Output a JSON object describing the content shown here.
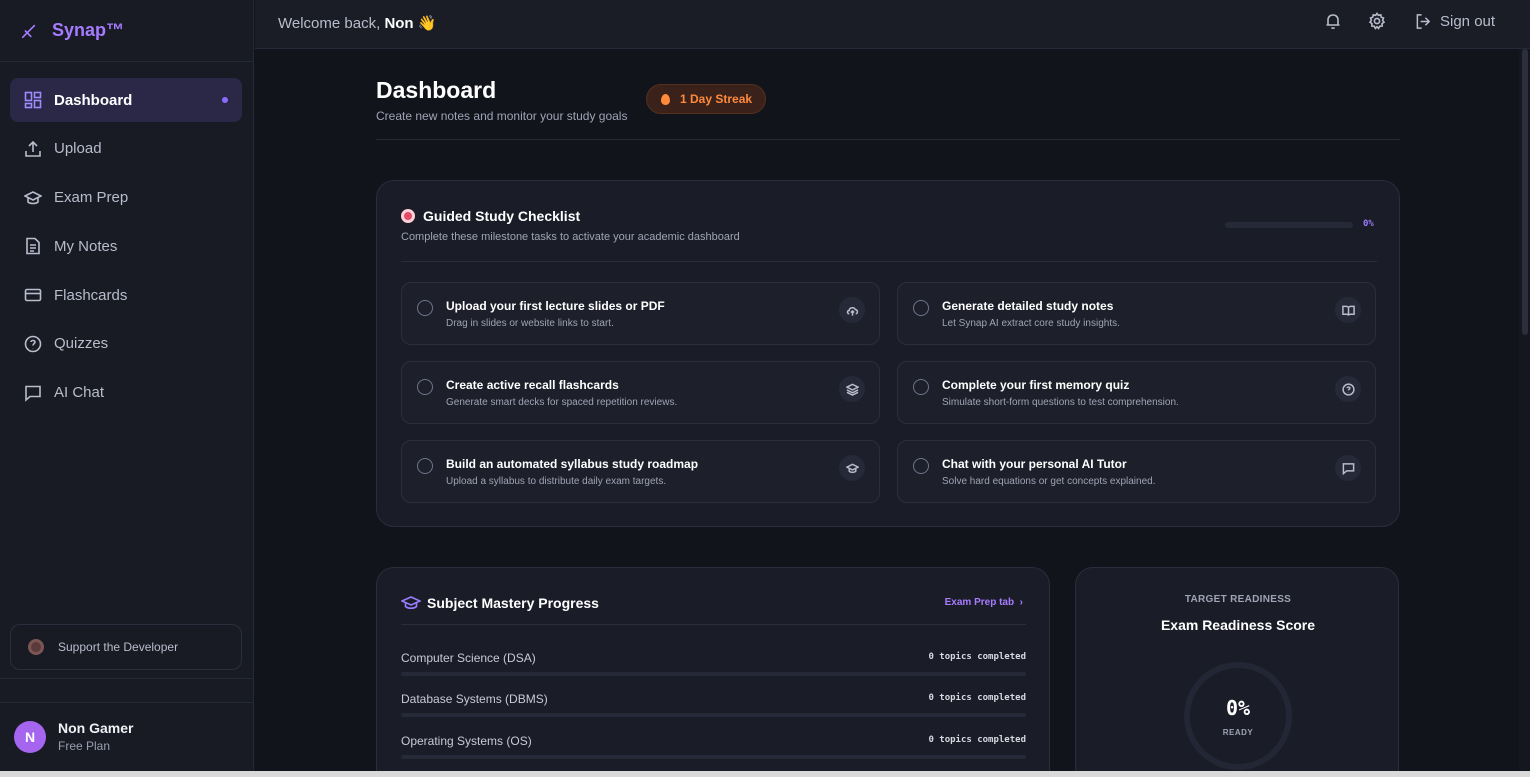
{
  "brand": {
    "name": "Synap™"
  },
  "topbar": {
    "welcome_prefix": "Welcome back,",
    "user_first": "Non",
    "wave": "👋",
    "signout_label": "Sign out"
  },
  "sidebar": {
    "items": [
      {
        "label": "Dashboard",
        "icon": "grid-icon",
        "active": true
      },
      {
        "label": "Upload",
        "icon": "upload-icon"
      },
      {
        "label": "Exam Prep",
        "icon": "graduation-cap-icon"
      },
      {
        "label": "My Notes",
        "icon": "file-text-icon"
      },
      {
        "label": "Flashcards",
        "icon": "credit-card-icon"
      },
      {
        "label": "Quizzes",
        "icon": "help-circle-icon"
      },
      {
        "label": "AI Chat",
        "icon": "message-square-icon"
      }
    ],
    "support_label": "Support the Developer"
  },
  "user": {
    "initial": "N",
    "name": "Non Gamer",
    "plan": "Free Plan"
  },
  "header": {
    "title": "Dashboard",
    "subtitle": "Create new notes and monitor your study goals",
    "streak": "1 Day Streak"
  },
  "checklist": {
    "title": "Guided Study Checklist",
    "subtitle": "Complete these milestone tasks to activate your academic dashboard",
    "progress_label": "0%",
    "progress": 0,
    "tasks": [
      {
        "title": "Upload your first lecture slides or PDF",
        "desc": "Drag in slides or website links to start.",
        "icon": "upload-cloud-icon"
      },
      {
        "title": "Generate detailed study notes",
        "desc": "Let Synap AI extract core study insights.",
        "icon": "book-open-icon"
      },
      {
        "title": "Create active recall flashcards",
        "desc": "Generate smart decks for spaced repetition reviews.",
        "icon": "layers-icon"
      },
      {
        "title": "Complete your first memory quiz",
        "desc": "Simulate short-form questions to test comprehension.",
        "icon": "help-circle-icon"
      },
      {
        "title": "Build an automated syllabus study roadmap",
        "desc": "Upload a syllabus to distribute daily exam targets.",
        "icon": "graduation-cap-icon"
      },
      {
        "title": "Chat with your personal AI Tutor",
        "desc": "Solve hard equations or get concepts explained.",
        "icon": "message-square-icon"
      }
    ]
  },
  "mastery": {
    "title": "Subject Mastery Progress",
    "link": "Exam Prep tab",
    "subjects": [
      {
        "name": "Computer Science (DSA)",
        "count": "0 topics completed",
        "progress": 0
      },
      {
        "name": "Database Systems (DBMS)",
        "count": "0 topics completed",
        "progress": 0
      },
      {
        "name": "Operating Systems (OS)",
        "count": "0 topics completed",
        "progress": 0
      }
    ]
  },
  "readiness": {
    "eyebrow": "TARGET READINESS",
    "title": "Exam Readiness Score",
    "value": "0%",
    "caption": "READY"
  }
}
